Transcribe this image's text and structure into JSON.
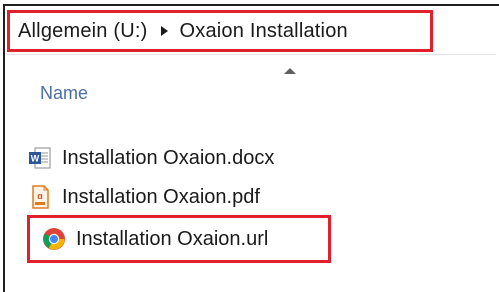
{
  "address_bar": {
    "crumbs": [
      "Allgemein (U:)",
      "Oxaion Installation"
    ]
  },
  "columns": {
    "name": "Name"
  },
  "files": [
    {
      "name": "Installation Oxaion.docx",
      "icon": "word-document-icon"
    },
    {
      "name": "Installation Oxaion.pdf",
      "icon": "pdf-document-icon"
    },
    {
      "name": "Installation Oxaion.url",
      "icon": "chrome-url-shortcut-icon"
    }
  ],
  "colors": {
    "highlight": "#e0202a",
    "column_header": "#4a6fa5"
  }
}
